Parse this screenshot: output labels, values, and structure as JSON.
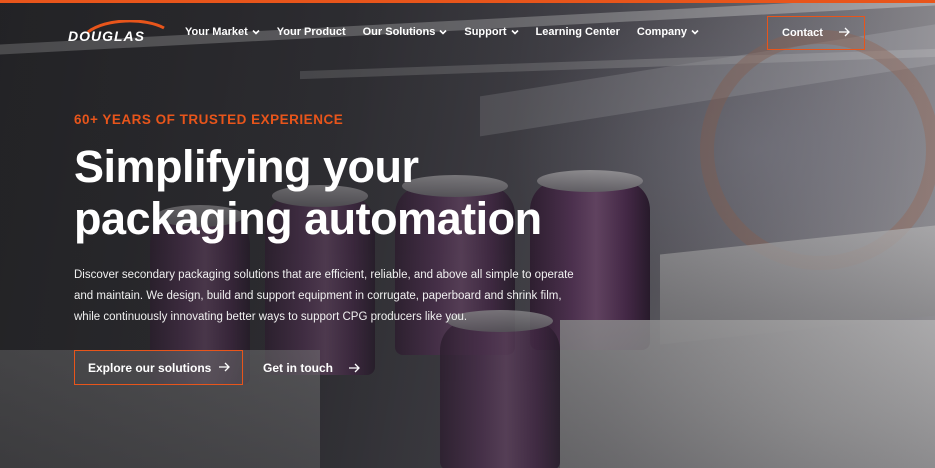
{
  "header": {
    "logo_text": "DOUGLAS",
    "nav": [
      {
        "label": "Your Market",
        "has_dropdown": true
      },
      {
        "label": "Your Product",
        "has_dropdown": false
      },
      {
        "label": "Our Solutions",
        "has_dropdown": true
      },
      {
        "label": "Support",
        "has_dropdown": true
      },
      {
        "label": "Learning Center",
        "has_dropdown": false
      },
      {
        "label": "Company",
        "has_dropdown": true
      }
    ],
    "contact_label": "Contact"
  },
  "hero": {
    "eyebrow": "60+ YEARS OF TRUSTED EXPERIENCE",
    "headline_line1": "Simplifying your",
    "headline_line2": "packaging automation",
    "description": "Discover secondary packaging solutions that are efficient, reliable, and above all simple to operate and maintain. We design, build and support equipment in corrugate, paperboard and shrink film, while continuously innovating better ways to support CPG producers like you.",
    "primary_cta": "Explore our solutions",
    "secondary_cta": "Get in touch"
  },
  "icons": {
    "chevron": "chevron-down-icon",
    "arrow": "arrow-right-icon"
  },
  "colors": {
    "accent": "#e8551b",
    "text": "#ffffff",
    "overlay": "#1e1e20"
  }
}
